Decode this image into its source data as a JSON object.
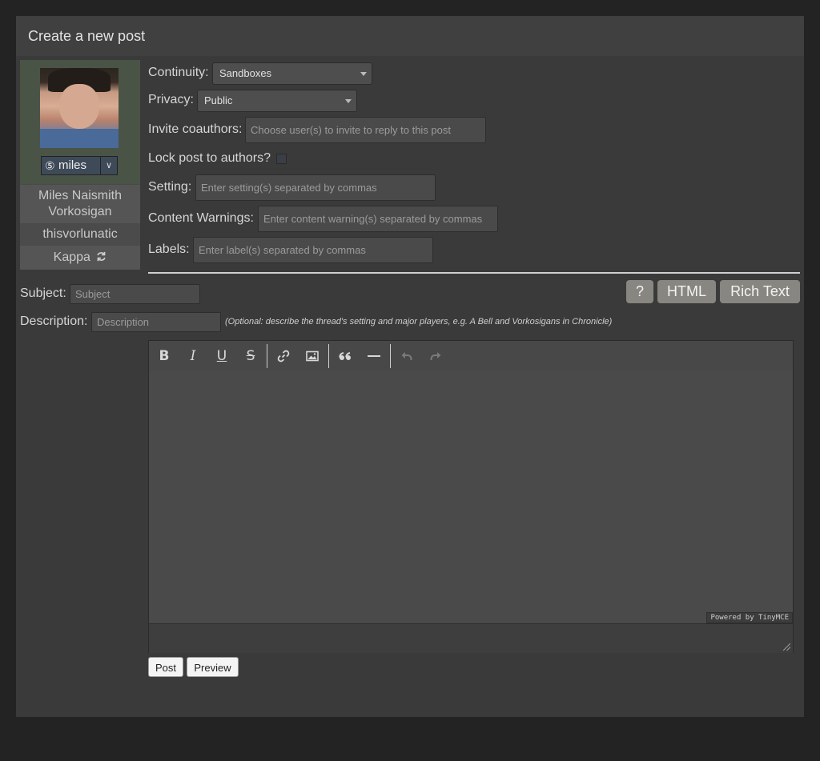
{
  "page": {
    "title": "Create a new post"
  },
  "character": {
    "icon_number": "⑤",
    "icon_name": "miles",
    "name": "Miles Naismith Vorkosigan",
    "username": "thisvorlunatic",
    "gallery": "Kappa",
    "swap_icon": "refresh-icon"
  },
  "fields": {
    "continuity": {
      "label": "Continuity:",
      "value": "Sandboxes"
    },
    "privacy": {
      "label": "Privacy:",
      "value": "Public"
    },
    "coauthors": {
      "label": "Invite coauthors:",
      "placeholder": "Choose user(s) to invite to reply to this post"
    },
    "lock": {
      "label": "Lock post to authors?"
    },
    "setting": {
      "label": "Setting:",
      "placeholder": "Enter setting(s) separated by commas"
    },
    "warnings": {
      "label": "Content Warnings:",
      "placeholder": "Enter content warning(s) separated by commas"
    },
    "labels": {
      "label": "Labels:",
      "placeholder": "Enter label(s) separated by commas"
    },
    "subject": {
      "label": "Subject:",
      "placeholder": "Subject"
    },
    "description": {
      "label": "Description:",
      "placeholder": "Description",
      "hint": "(Optional: describe the thread's setting and major players, e.g. A Bell and Vorkosigans in Chronicle)"
    }
  },
  "editor_modes": {
    "help": "?",
    "html": "HTML",
    "rich": "Rich Text"
  },
  "editor": {
    "powered_by": "Powered by TinyMCE",
    "toolbar": {
      "bold": "B",
      "italic": "I",
      "underline": "U",
      "strike": "S",
      "link": "link-icon",
      "image": "image-icon",
      "quote": "quote-icon",
      "hr": "horizontal-rule-icon",
      "undo": "undo-icon",
      "redo": "redo-icon"
    }
  },
  "actions": {
    "post": "Post",
    "preview": "Preview"
  },
  "colors": {
    "background": "#232323",
    "panel": "#3a3a3a",
    "header": "#404040",
    "mode_button": "#888680"
  }
}
